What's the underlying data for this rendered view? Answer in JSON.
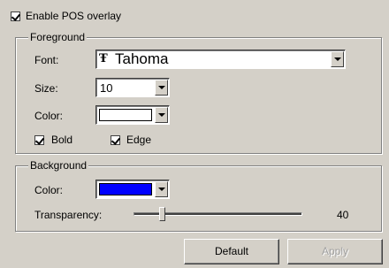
{
  "overlay": {
    "enable_label": "Enable POS overlay",
    "enabled": true
  },
  "foreground": {
    "legend": "Foreground",
    "font_label": "Font:",
    "font_icon": "Ŧ",
    "font_value": "Tahoma",
    "size_label": "Size:",
    "size_value": "10",
    "color_label": "Color:",
    "color_value": "#ffffff",
    "bold_label": "Bold",
    "bold_checked": true,
    "edge_label": "Edge",
    "edge_checked": true
  },
  "background": {
    "legend": "Background",
    "color_label": "Color:",
    "color_value": "#0000ff",
    "transparency_label": "Transparency:",
    "transparency_value": "40",
    "transparency_fraction": 0.17
  },
  "buttons": {
    "default_label": "Default",
    "apply_label": "Apply"
  }
}
